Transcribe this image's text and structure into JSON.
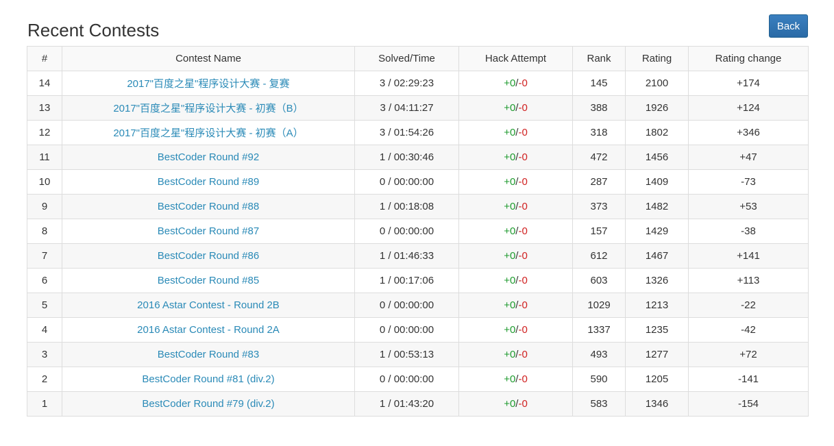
{
  "page": {
    "title": "Recent Contests",
    "back_label": "Back"
  },
  "colors": {
    "link": "#2a8ab7",
    "hack_success": "#1e9a2e",
    "hack_fail": "#d02020",
    "button": "#2a6aa6"
  },
  "table": {
    "headers": [
      "#",
      "Contest Name",
      "Solved/Time",
      "Hack Attempt",
      "Rank",
      "Rating",
      "Rating change"
    ],
    "hack_separator": "/",
    "rows": [
      {
        "id": "14",
        "name": "2017\"百度之星\"程序设计大赛 - 复赛",
        "solved": "3 / 02:29:23",
        "hack_plus": "+0",
        "hack_minus": "-0",
        "rank": "145",
        "rating": "2100",
        "change": "+174"
      },
      {
        "id": "13",
        "name": "2017\"百度之星\"程序设计大赛 - 初赛（B）",
        "solved": "3 / 04:11:27",
        "hack_plus": "+0",
        "hack_minus": "-0",
        "rank": "388",
        "rating": "1926",
        "change": "+124"
      },
      {
        "id": "12",
        "name": "2017\"百度之星\"程序设计大赛 - 初赛（A）",
        "solved": "3 / 01:54:26",
        "hack_plus": "+0",
        "hack_minus": "-0",
        "rank": "318",
        "rating": "1802",
        "change": "+346"
      },
      {
        "id": "11",
        "name": "BestCoder Round #92",
        "solved": "1 / 00:30:46",
        "hack_plus": "+0",
        "hack_minus": "-0",
        "rank": "472",
        "rating": "1456",
        "change": "+47"
      },
      {
        "id": "10",
        "name": "BestCoder Round #89",
        "solved": "0 / 00:00:00",
        "hack_plus": "+0",
        "hack_minus": "-0",
        "rank": "287",
        "rating": "1409",
        "change": "-73"
      },
      {
        "id": "9",
        "name": "BestCoder Round #88",
        "solved": "1 / 00:18:08",
        "hack_plus": "+0",
        "hack_minus": "-0",
        "rank": "373",
        "rating": "1482",
        "change": "+53"
      },
      {
        "id": "8",
        "name": "BestCoder Round #87",
        "solved": "0 / 00:00:00",
        "hack_plus": "+0",
        "hack_minus": "-0",
        "rank": "157",
        "rating": "1429",
        "change": "-38"
      },
      {
        "id": "7",
        "name": "BestCoder Round #86",
        "solved": "1 / 01:46:33",
        "hack_plus": "+0",
        "hack_minus": "-0",
        "rank": "612",
        "rating": "1467",
        "change": "+141"
      },
      {
        "id": "6",
        "name": "BestCoder Round #85",
        "solved": "1 / 00:17:06",
        "hack_plus": "+0",
        "hack_minus": "-0",
        "rank": "603",
        "rating": "1326",
        "change": "+113"
      },
      {
        "id": "5",
        "name": "2016 Astar Contest - Round 2B",
        "solved": "0 / 00:00:00",
        "hack_plus": "+0",
        "hack_minus": "-0",
        "rank": "1029",
        "rating": "1213",
        "change": "-22"
      },
      {
        "id": "4",
        "name": "2016 Astar Contest - Round 2A",
        "solved": "0 / 00:00:00",
        "hack_plus": "+0",
        "hack_minus": "-0",
        "rank": "1337",
        "rating": "1235",
        "change": "-42"
      },
      {
        "id": "3",
        "name": "BestCoder Round #83",
        "solved": "1 / 00:53:13",
        "hack_plus": "+0",
        "hack_minus": "-0",
        "rank": "493",
        "rating": "1277",
        "change": "+72"
      },
      {
        "id": "2",
        "name": "BestCoder Round #81 (div.2)",
        "solved": "0 / 00:00:00",
        "hack_plus": "+0",
        "hack_minus": "-0",
        "rank": "590",
        "rating": "1205",
        "change": "-141"
      },
      {
        "id": "1",
        "name": "BestCoder Round #79 (div.2)",
        "solved": "1 / 01:43:20",
        "hack_plus": "+0",
        "hack_minus": "-0",
        "rank": "583",
        "rating": "1346",
        "change": "-154"
      }
    ]
  }
}
